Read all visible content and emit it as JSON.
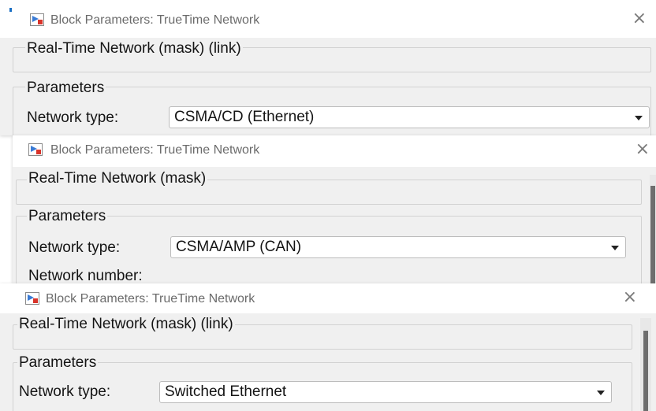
{
  "windows": [
    {
      "title": "Block Parameters: TrueTime Network",
      "close_glyph": "×",
      "icon": "simulink-block-icon",
      "mask_heading": "Real-Time Network (mask) (link)",
      "params_heading": "Parameters",
      "network_type_label": "Network type:",
      "network_type_value": "CSMA/CD (Ethernet)"
    },
    {
      "title": "Block Parameters: TrueTime Network",
      "close_glyph": "×",
      "icon": "simulink-block-icon",
      "mask_heading": "Real-Time Network (mask)",
      "params_heading": "Parameters",
      "network_type_label": "Network type:",
      "network_type_value": "CSMA/AMP (CAN)",
      "network_number_label": "Network number:"
    },
    {
      "title": "Block Parameters: TrueTime Network",
      "close_glyph": "×",
      "icon": "simulink-block-icon",
      "mask_heading": "Real-Time Network (mask) (link)",
      "params_heading": "Parameters",
      "network_type_label": "Network type:",
      "network_type_value": "Switched Ethernet"
    }
  ],
  "colors": {
    "title_text": "#6b6b6b",
    "panel_bg": "#f0f0f0",
    "icon_blue": "#3a7bd5",
    "icon_red": "#d9342b"
  }
}
